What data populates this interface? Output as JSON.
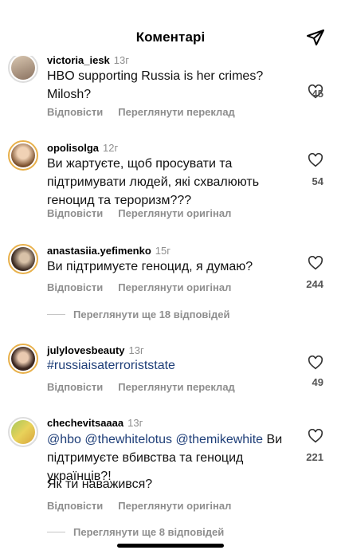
{
  "header": {
    "title": "Коментарі"
  },
  "actions": {
    "reply": "Відповісти",
    "view_translation": "Переглянути переклад",
    "view_original": "Переглянути оригінал"
  },
  "comments": [
    {
      "username": "victoria_iesk",
      "time": "13г",
      "text": "HBO supporting Russia is her crimes? Milosh?",
      "likes": "45",
      "second_action": "Переглянути переклад"
    },
    {
      "username": "opolisolga",
      "time": "12г",
      "text": "Ви жартуєте, щоб просувати та підтримувати людей, які схвалюють геноцид та тероризм???",
      "likes": "54",
      "second_action": "Переглянути оригінал"
    },
    {
      "username": "anastasiia.yefimenko",
      "time": "15г",
      "text": "Ви підтримуєте геноцид, я думаю?",
      "likes": "244",
      "second_action": "Переглянути оригінал",
      "more_replies": "Переглянути ще 18 відповідей"
    },
    {
      "username": "julylovesbeauty",
      "time": "13г",
      "text": "#russiaisaterroriststate",
      "likes": "49",
      "second_action": "Переглянути переклад"
    },
    {
      "username": "chechevitsaaaa",
      "time": "13г",
      "mentions": "@hbo @thewhitelotus @themikewhite",
      "text_after": " Ви підтримуєте вбивства та геноцид українців?!",
      "text2": "Як ти наважився?",
      "likes": "221",
      "second_action": "Переглянути оригінал",
      "more_replies": "Переглянути ще 8 відповідей"
    }
  ],
  "colors": {
    "avatar_ring": "#e8b04a",
    "mention": "#1e3e78",
    "muted": "#8e8e8e"
  }
}
